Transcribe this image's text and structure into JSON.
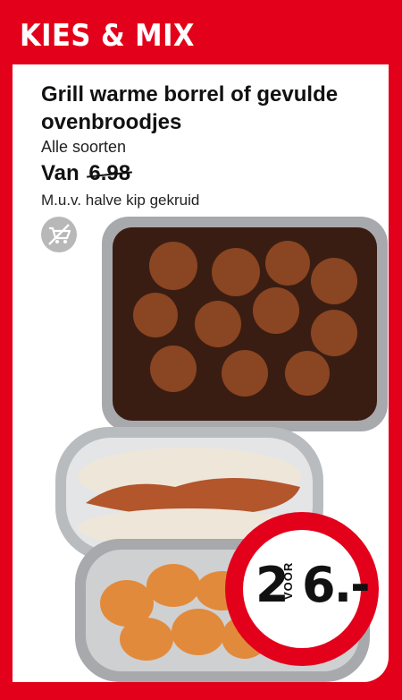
{
  "banner": {
    "label": "KIES & MIX"
  },
  "product": {
    "title": "Grill warme borrel of gevulde ovenbroodjes",
    "subtitle": "Alle soorten",
    "price_prefix": "Van",
    "old_price": "6.98",
    "note": "M.u.v. halve kip gekruid"
  },
  "icons": {
    "no_delivery": "no-delivery-cart-icon"
  },
  "offer": {
    "quantity": "2",
    "voor": "VOOR",
    "price": "6.-"
  },
  "colors": {
    "brand_red": "#e3001b",
    "icon_gray": "#b8b8b8"
  }
}
